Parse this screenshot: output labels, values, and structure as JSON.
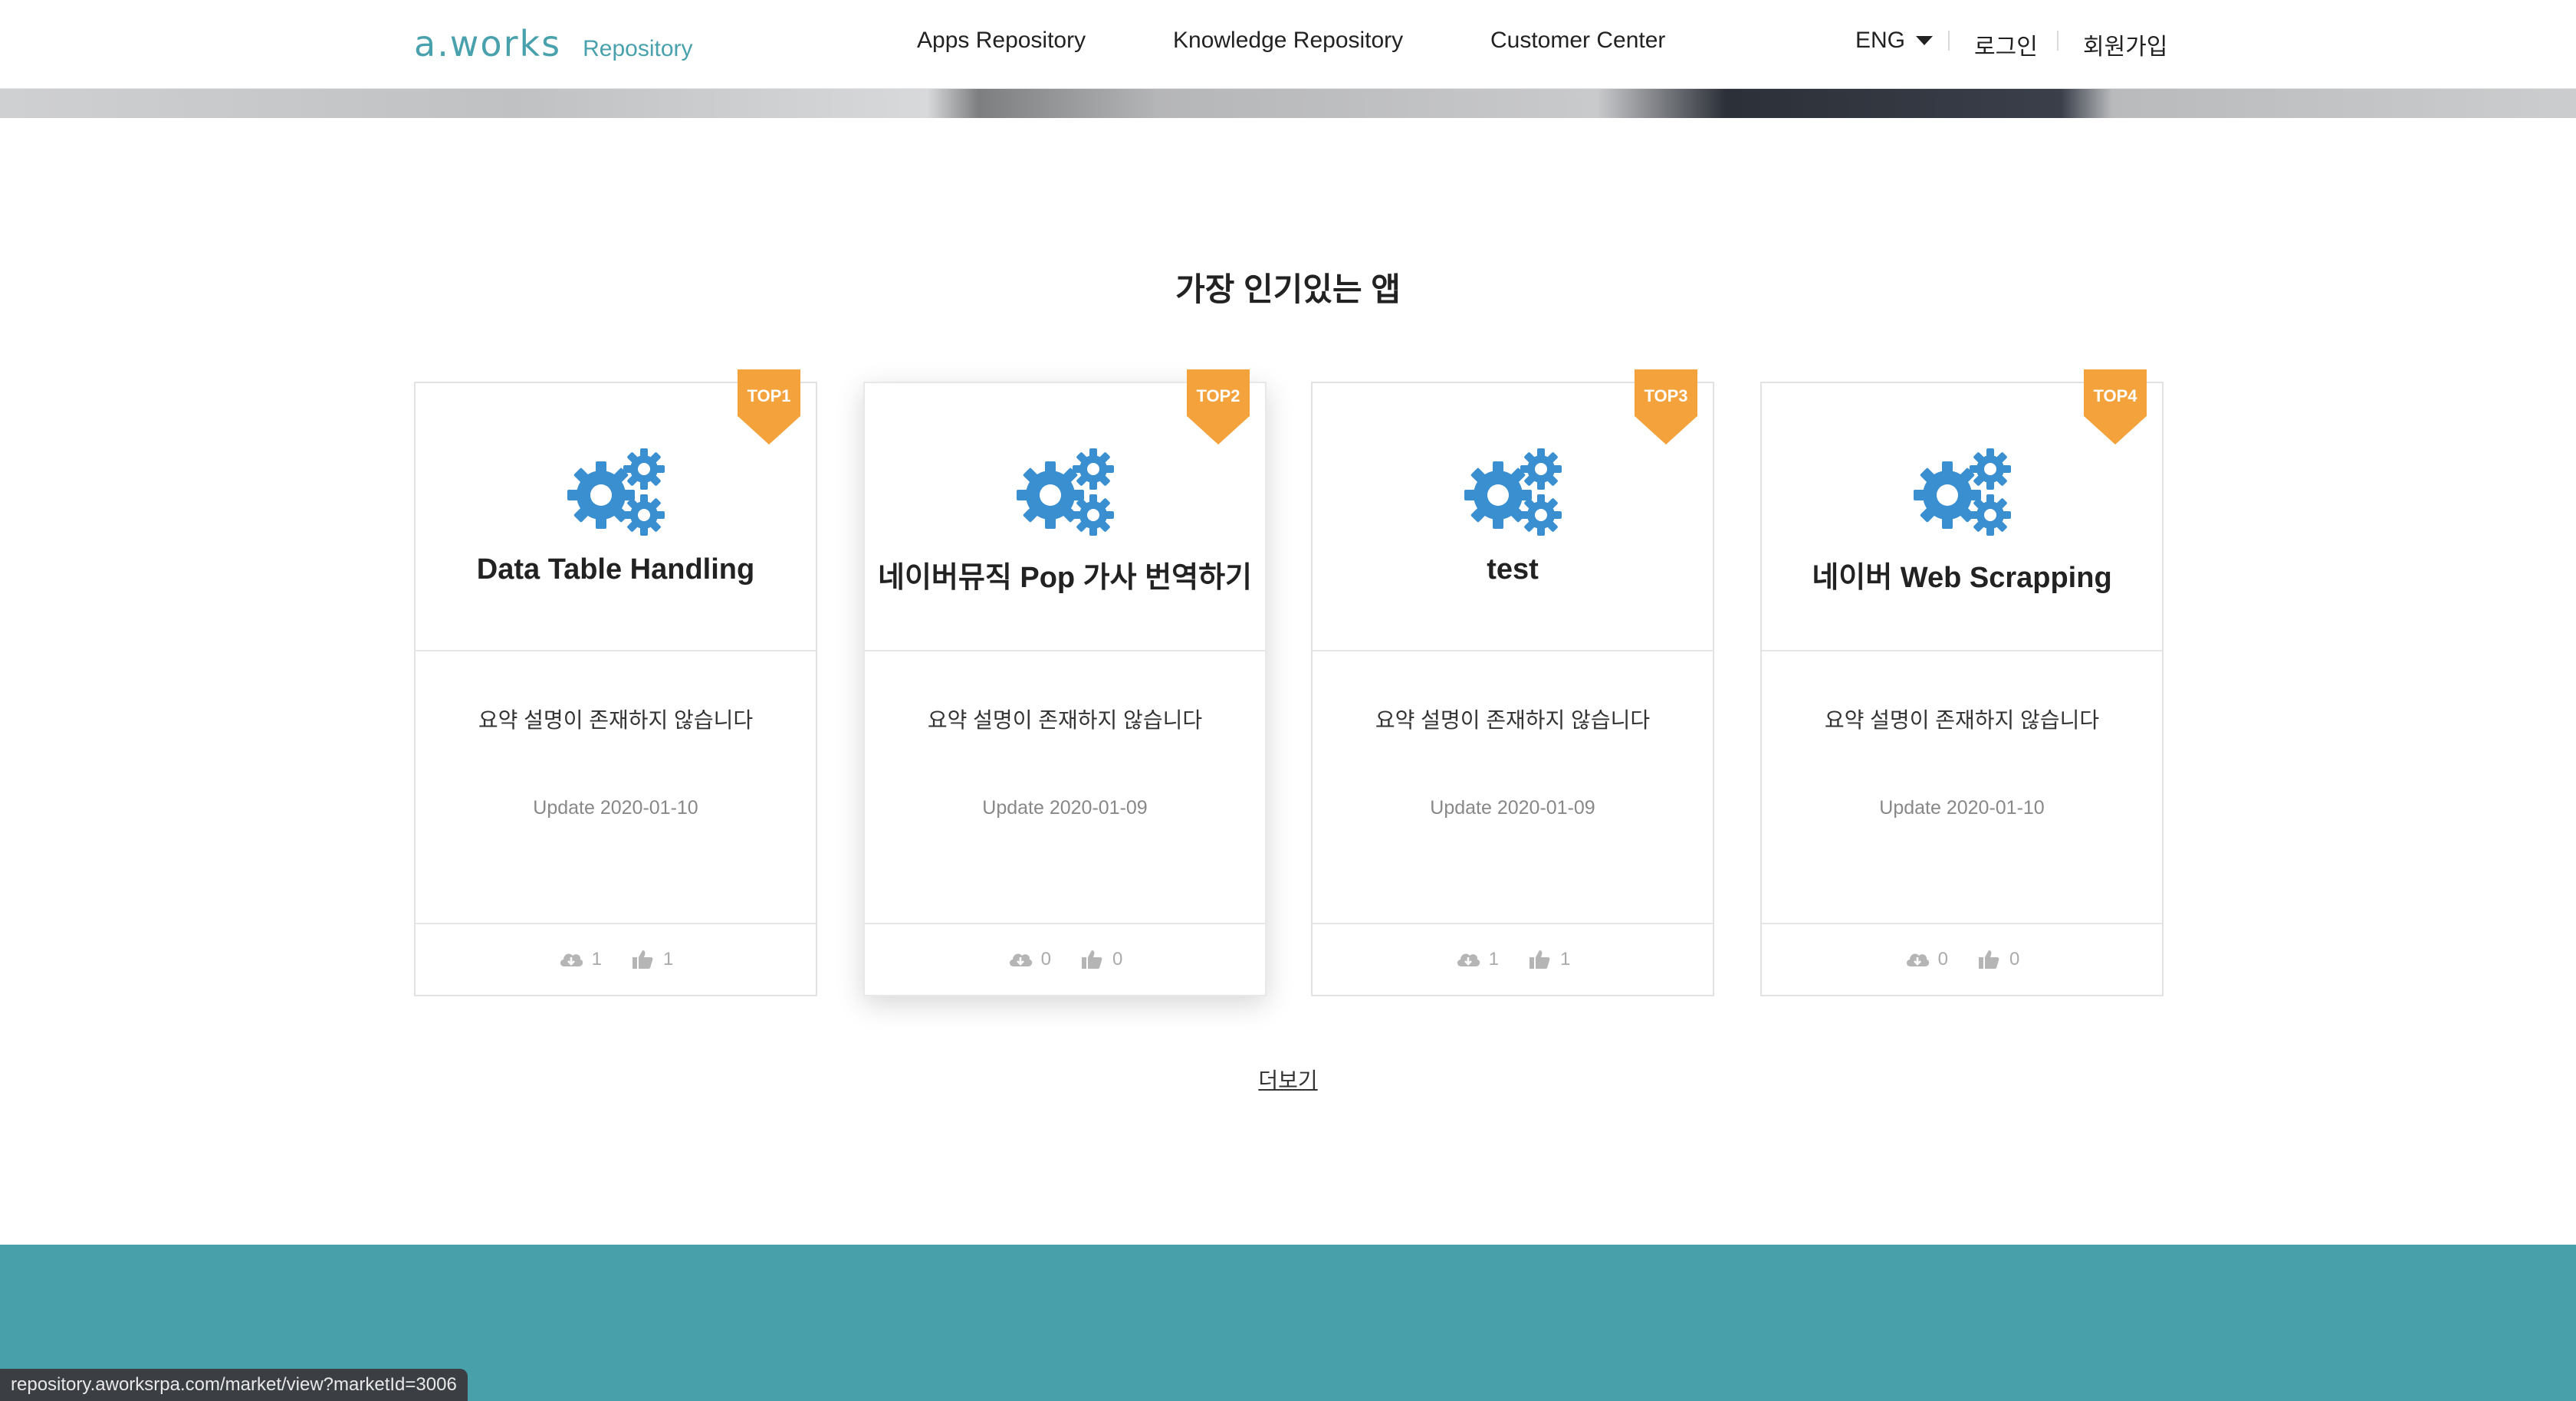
{
  "header": {
    "logo_text": "a.works",
    "logo_sub": "Repository",
    "nav": [
      "Apps Repository",
      "Knowledge Repository",
      "Customer Center"
    ],
    "language": "ENG",
    "login": "로그인",
    "signup": "회원가입"
  },
  "section": {
    "title": "가장 인기있는 앱",
    "more_link": "더보기"
  },
  "cards": [
    {
      "badge": "TOP1",
      "name": "Data Table Handling",
      "summary": "요약 설명이 존재하지 않습니다",
      "updated": "Update 2020-01-10",
      "downloads": "1",
      "likes": "1"
    },
    {
      "badge": "TOP2",
      "name": "네이버뮤직 Pop 가사 번역하기",
      "summary": "요약 설명이 존재하지 않습니다",
      "updated": "Update 2020-01-09",
      "downloads": "0",
      "likes": "0"
    },
    {
      "badge": "TOP3",
      "name": "test",
      "summary": "요약 설명이 존재하지 않습니다",
      "updated": "Update 2020-01-09",
      "downloads": "1",
      "likes": "1"
    },
    {
      "badge": "TOP4",
      "name": "네이버 Web Scrapping",
      "summary": "요약 설명이 존재하지 않습니다",
      "updated": "Update 2020-01-10",
      "downloads": "0",
      "likes": "0"
    }
  ],
  "status_url": "repository.aworksrpa.com/market/view?marketId=3006",
  "colors": {
    "brand": "#49a1ad",
    "badge": "#f3a23c",
    "gear": "#3a8fd0",
    "footer": "#48a0ab"
  },
  "icons": {
    "gear": "gears-icon",
    "download": "cloud-download-icon",
    "like": "thumbs-up-icon",
    "caret": "caret-down-icon"
  }
}
